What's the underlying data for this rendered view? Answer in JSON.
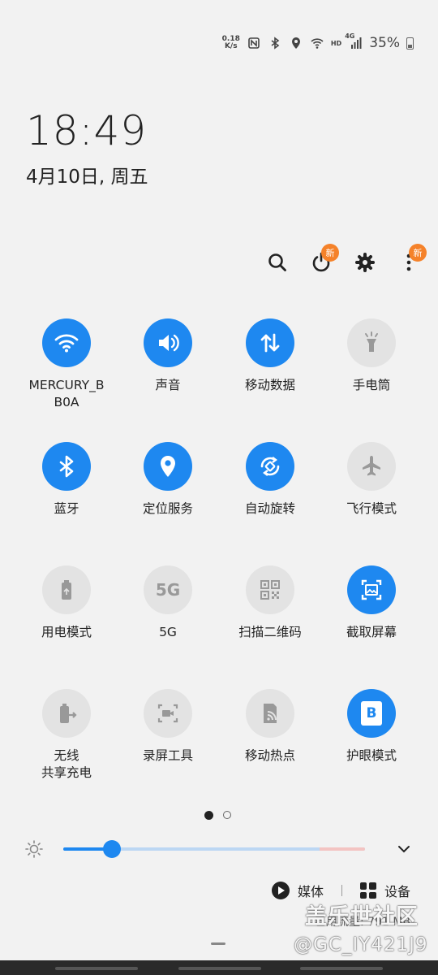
{
  "status_bar": {
    "net_speed_value": "0.18",
    "net_speed_unit": "K/s",
    "hd_label": "HD",
    "network_label": "4G",
    "battery_percent": "35%",
    "icons": [
      "nfc-icon",
      "bluetooth-icon",
      "location-icon",
      "wifi-icon",
      "signal-icon",
      "battery-icon"
    ]
  },
  "clock": {
    "time": "18:49",
    "date": "4月10日, 周五"
  },
  "toolbar": {
    "badge_label": "新",
    "icons": [
      "search-icon",
      "power-icon",
      "settings-icon",
      "more-icon"
    ]
  },
  "tiles": [
    {
      "label": "MERCURY_B\nB0A",
      "icon": "wifi-icon",
      "on": true
    },
    {
      "label": "声音",
      "icon": "sound-icon",
      "on": true
    },
    {
      "label": "移动数据",
      "icon": "mobile-data-icon",
      "on": true
    },
    {
      "label": "手电筒",
      "icon": "flashlight-icon",
      "on": false
    },
    {
      "label": "蓝牙",
      "icon": "bluetooth-icon",
      "on": true
    },
    {
      "label": "定位服务",
      "icon": "location-icon",
      "on": true
    },
    {
      "label": "自动旋转",
      "icon": "auto-rotate-icon",
      "on": true
    },
    {
      "label": "飞行模式",
      "icon": "airplane-icon",
      "on": false
    },
    {
      "label": "用电模式",
      "icon": "power-mode-icon",
      "on": false
    },
    {
      "label": "5G",
      "icon": "5g-icon",
      "on": false
    },
    {
      "label": "扫描二维码",
      "icon": "qr-code-icon",
      "on": false
    },
    {
      "label": "截取屏幕",
      "icon": "screenshot-icon",
      "on": true
    },
    {
      "label": "无线\n共享充电",
      "icon": "wireless-share-icon",
      "on": false
    },
    {
      "label": "录屏工具",
      "icon": "screen-record-icon",
      "on": false
    },
    {
      "label": "移动热点",
      "icon": "hotspot-icon",
      "on": false
    },
    {
      "label": "护眼模式",
      "icon": "eye-comfort-icon",
      "on": true
    }
  ],
  "icon_text": {
    "fiveg": "5G",
    "eye_b": "B"
  },
  "pager": {
    "pages": 2,
    "current": 1
  },
  "brightness": {
    "level": 0.16,
    "warn_level": 0.85
  },
  "bottom": {
    "media_label": "媒体",
    "devices_label": "设备",
    "data_usage": "已用流量: 791 MB"
  },
  "watermark": {
    "line1": "盖乐世社区",
    "line2": "@GC_IY421J9"
  },
  "colors": {
    "accent": "#1e88f0",
    "badge": "#f5822a",
    "tile_off": "#e3e3e3",
    "background": "#f2f2f2"
  }
}
